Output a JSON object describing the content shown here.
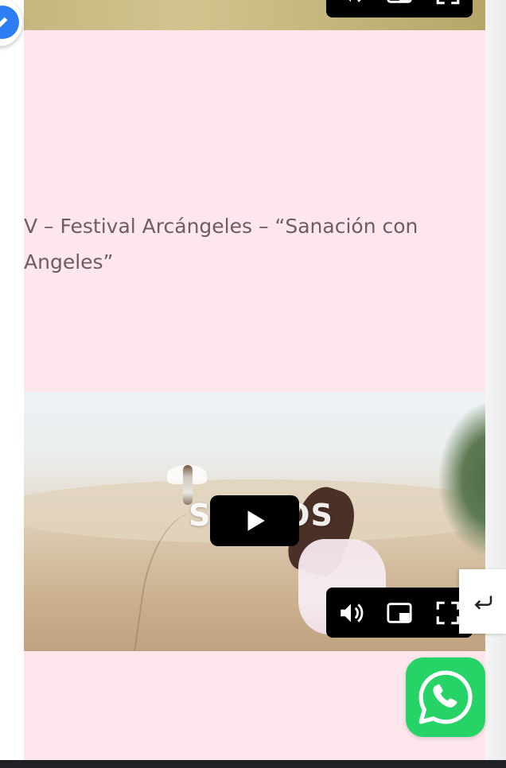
{
  "section": {
    "title": "V – Festival Arcángeles – “Sanación con Angeles”"
  },
  "video_main": {
    "overlay_text": "SUEÑOS"
  },
  "colors": {
    "content_background": "#fde7ec",
    "title_text": "#6b5d63",
    "whatsapp_green": "#25d366",
    "edit_blue": "#2f7df2"
  },
  "icons": {
    "video_top_controls": [
      "volume-icon",
      "picture-in-picture-icon",
      "fullscreen-icon"
    ],
    "video_main_controls": [
      "play-icon",
      "volume-icon",
      "picture-in-picture-icon",
      "fullscreen-icon"
    ],
    "edit_button": "pencil-icon",
    "back_button": "return-arrow-icon",
    "chat_button": "whatsapp-icon"
  }
}
